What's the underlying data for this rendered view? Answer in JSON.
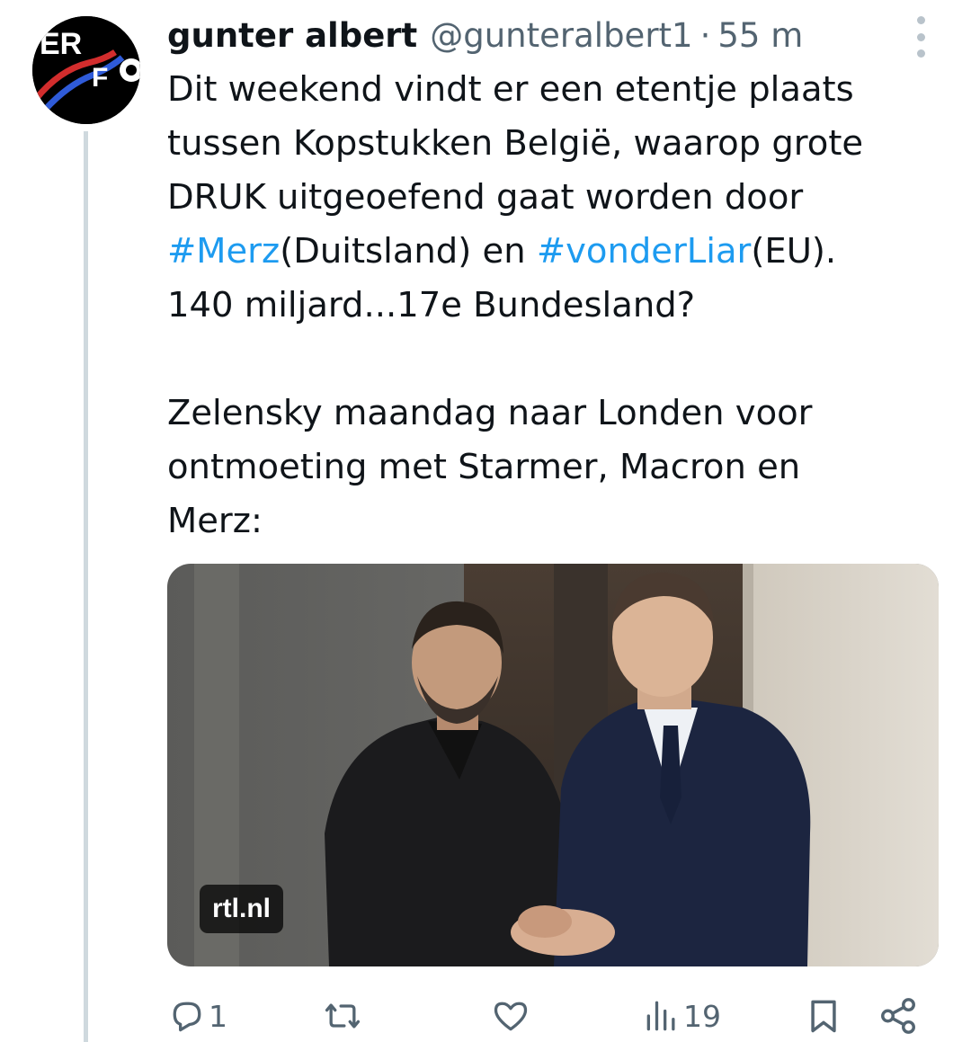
{
  "avatar": {
    "alt": "ERFC",
    "letters_top": "ER",
    "letter_f": "F",
    "letter_c": "C",
    "colors": {
      "background": "#000000",
      "letters": "#ffffff",
      "red_stripe": "#d22d2d",
      "blue_stripe": "#2f5bd8"
    }
  },
  "author": {
    "name": "gunter albert",
    "handle": "@gunteralbert1",
    "separator": "·",
    "time": "55 m"
  },
  "post": {
    "line1": "Dit weekend vindt er een etentje plaats",
    "line2": "tussen Kopstukken België, waarop grote",
    "line3": "DRUK uitgeoefend gaat worden door",
    "hashtag1": "#Merz",
    "line4_mid": "(Duitsland) en ",
    "hashtag2": "#vonderLiar",
    "line4_end": "(EU).",
    "line5": "140 miljard...17e Bundesland?",
    "line6": "Zelensky maandag naar Londen voor",
    "line7": "ontmoeting met Starmer, Macron en",
    "line8": "Merz:"
  },
  "media": {
    "domain": "rtl.nl"
  },
  "actions": {
    "replies": "1",
    "reposts": "",
    "likes": "",
    "views": "19"
  },
  "icons": {
    "more": "more-vertical-icon",
    "reply": "reply-bubble-icon",
    "repost": "repost-arrows-icon",
    "like": "heart-icon",
    "views": "views-bars-icon",
    "bookmark": "bookmark-icon",
    "share": "share-icon"
  },
  "colors": {
    "text": "#0f1419",
    "secondary": "#536471",
    "link": "#1d9bf0",
    "thread_line": "#cfd9de"
  }
}
